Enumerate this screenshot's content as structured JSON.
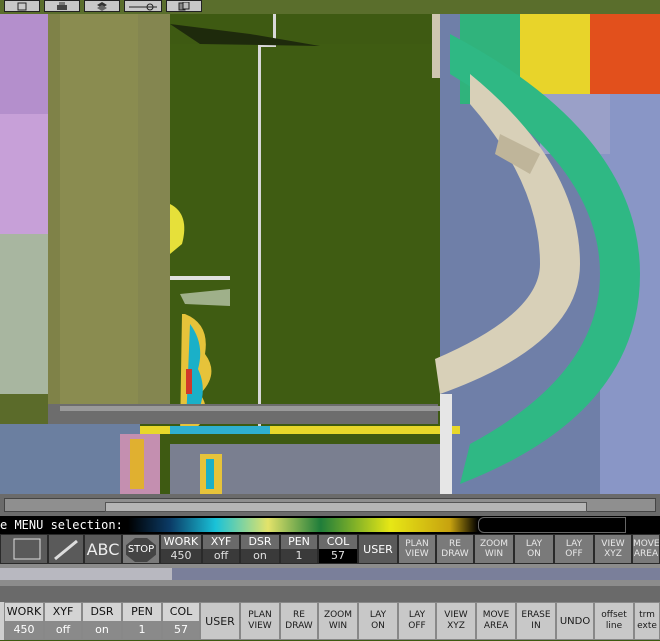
{
  "toolbar": {
    "buttons": [
      "file-icon",
      "print-icon",
      "layers-icon",
      "line-tool-icon",
      "copy-icon"
    ]
  },
  "prompt": {
    "text": "e MENU selection:"
  },
  "status_fields": [
    {
      "name": "WORK",
      "value": "450"
    },
    {
      "name": "XYF",
      "value": "off"
    },
    {
      "name": "DSR",
      "value": "on"
    },
    {
      "name": "PEN",
      "value": "1"
    },
    {
      "name": "COL",
      "value": "57"
    }
  ],
  "user_label": "USER",
  "stop_label": "STOP",
  "abc_label": "ABC",
  "commands": [
    {
      "l1": "PLAN",
      "l2": "VIEW"
    },
    {
      "l1": "RE",
      "l2": "DRAW"
    },
    {
      "l1": "ZOOM",
      "l2": "WIN"
    },
    {
      "l1": "LAY",
      "l2": "ON"
    },
    {
      "l1": "LAY",
      "l2": "OFF"
    },
    {
      "l1": "VIEW",
      "l2": "XYZ"
    },
    {
      "l1": "MOVE",
      "l2": "AREA"
    }
  ],
  "bottom_commands": [
    {
      "l1": "PLAN",
      "l2": "VIEW"
    },
    {
      "l1": "RE",
      "l2": "DRAW"
    },
    {
      "l1": "ZOOM",
      "l2": "WIN"
    },
    {
      "l1": "LAY",
      "l2": "ON"
    },
    {
      "l1": "LAY",
      "l2": "OFF"
    },
    {
      "l1": "VIEW",
      "l2": "XYZ"
    },
    {
      "l1": "MOVE",
      "l2": "AREA"
    },
    {
      "l1": "ERASE",
      "l2": "IN"
    },
    {
      "l1": "UNDO",
      "l2": ""
    },
    {
      "l1": "offset",
      "l2": "line"
    },
    {
      "l1": "trm",
      "l2": "exte"
    }
  ],
  "colors": {
    "canvas": "#3e5a12",
    "accent_green": "#2fb884",
    "beige": "#d8d0b8",
    "panel": "#7a7a7a"
  }
}
